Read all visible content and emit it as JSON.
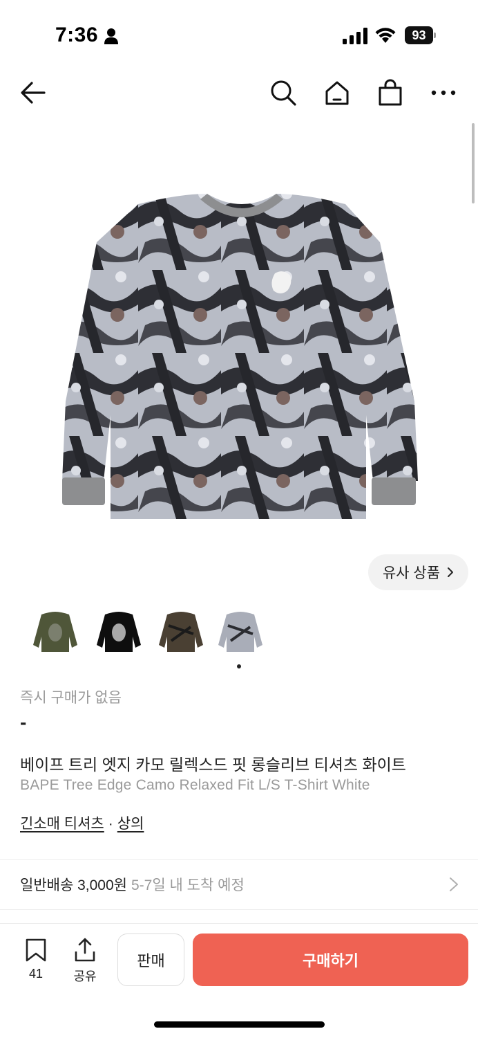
{
  "status": {
    "time": "7:36",
    "battery": "93"
  },
  "nav": {
    "icons": [
      "back-arrow-icon",
      "search-icon",
      "home-icon",
      "shopping-bag-icon",
      "more-icon"
    ]
  },
  "product": {
    "similar_label": "유사 상품",
    "instant_label": "즉시 구매가 없음",
    "price": "-",
    "title_ko": "베이프 트리 엣지 카모 릴렉스드 핏 롱슬리브 티셔츠 화이트",
    "title_en": "BAPE Tree Edge Camo Relaxed Fit L/S T-Shirt White",
    "categories": [
      "긴소매 티셔츠",
      "상의"
    ],
    "category_sep": "·"
  },
  "delivery": {
    "main": "일반배송 3,000원",
    "sub": "5-7일 내 도착 예정"
  },
  "bottom": {
    "bookmark_count": "41",
    "share_label": "공유",
    "sell_label": "판매",
    "buy_label": "구매하기"
  },
  "colors": {
    "accent": "#ef6253",
    "muted_text": "#9a9a9a"
  }
}
